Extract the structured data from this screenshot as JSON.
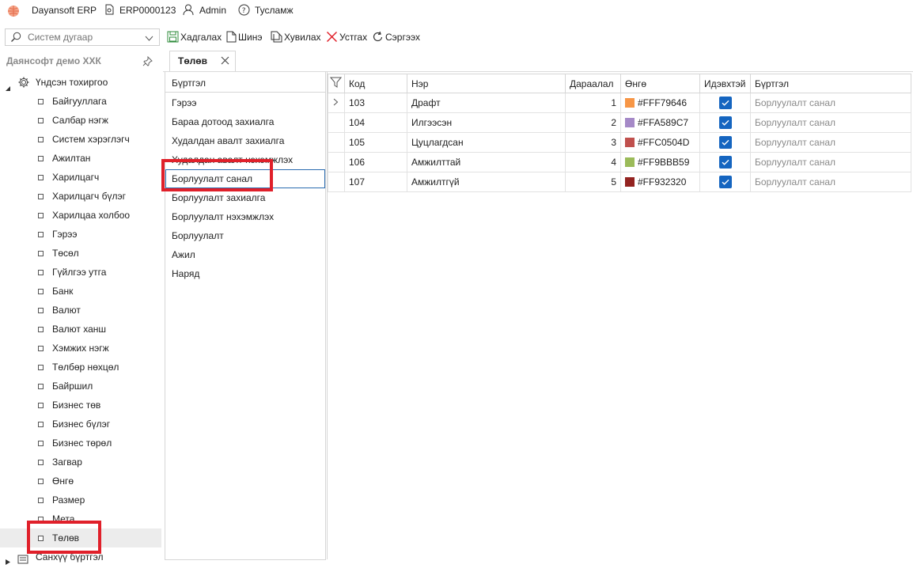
{
  "topbar": {
    "app_name": "Dayansoft ERP",
    "db_name": "ERP0000123",
    "user": "Admin",
    "help": "Тусламж"
  },
  "toolbar": {
    "search_placeholder": "Систем дугаар",
    "save_label": "Хадгалах",
    "new_label": "Шинэ",
    "copy_label": "Хувилах",
    "delete_label": "Устгах",
    "refresh_label": "Сэргээх"
  },
  "sidebar": {
    "title": "Даянсофт демо ХХК",
    "root_label": "Үндсэн тохиргоо",
    "items": [
      "Байгууллага",
      "Салбар нэгж",
      "Систем хэрэглэгч",
      "Ажилтан",
      "Харилцагч",
      "Харилцагч бүлэг",
      "Харилцаа холбоо",
      "Гэрээ",
      "Төсөл",
      "Гүйлгээ утга",
      "Банк",
      "Валют",
      "Валют ханш",
      "Хэмжих нэгж",
      "Төлбөр нөхцөл",
      "Байршил",
      "Бизнес төв",
      "Бизнес бүлэг",
      "Бизнес төрөл",
      "Загвар",
      "Өнгө",
      "Размер",
      "Мета",
      "Төлөв"
    ],
    "next_root_label": "Санхүү бүртгэл"
  },
  "tab": {
    "label": "Төлөв"
  },
  "register_list": {
    "header": "Бүртгэл",
    "items": [
      "Гэрээ",
      "Бараа дотоод захиалга",
      "Худалдан авалт захиалга",
      "Худалдан авалт нэхэмжлэх",
      "Борлуулалт санал",
      "Борлуулалт захиалга",
      "Борлуулалт нэхэмжлэх",
      "Борлуулалт",
      "Ажил",
      "Наряд"
    ],
    "selected": "Борлуулалт санал"
  },
  "grid": {
    "columns": [
      "Код",
      "Нэр",
      "Дараалал",
      "Өнгө",
      "Идэвхтэй",
      "Бүртгэл"
    ],
    "rows": [
      {
        "code": "103",
        "name": "Драфт",
        "order": "1",
        "color_label": "#FFF79646",
        "color": "#F79646",
        "active": true,
        "register": "Борлуулалт санал"
      },
      {
        "code": "104",
        "name": "Илгээсэн",
        "order": "2",
        "color_label": "#FFA589C7",
        "color": "#A589C7",
        "active": true,
        "register": "Борлуулалт санал"
      },
      {
        "code": "105",
        "name": "Цуцлагдсан",
        "order": "3",
        "color_label": "#FFC0504D",
        "color": "#C0504D",
        "active": true,
        "register": "Борлуулалт санал"
      },
      {
        "code": "106",
        "name": "Амжилттай",
        "order": "4",
        "color_label": "#FF9BBB59",
        "color": "#9BBB59",
        "active": true,
        "register": "Борлуулалт санал"
      },
      {
        "code": "107",
        "name": "Амжилтгүй",
        "order": "5",
        "color_label": "#FF932320",
        "color": "#932320",
        "active": true,
        "register": "Борлуулалт санал"
      }
    ]
  },
  "colors": {
    "highlight": "#e0202a",
    "checkbox": "#1565c0",
    "selection_border": "#2b6cb0"
  }
}
